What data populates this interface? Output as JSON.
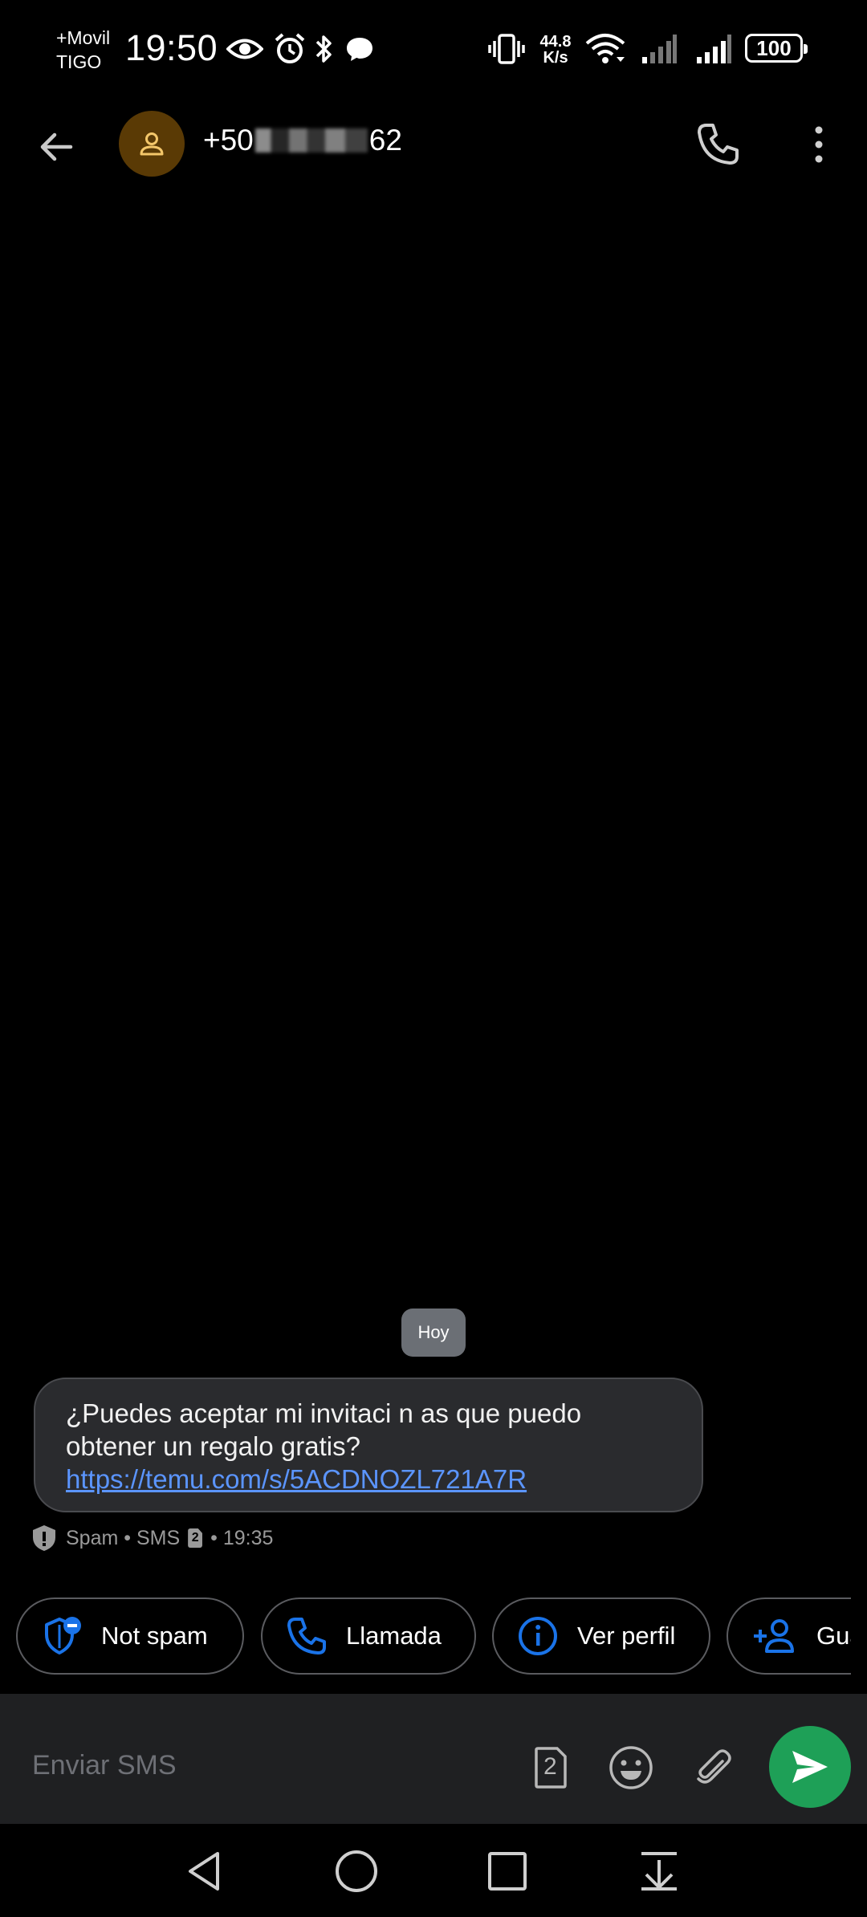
{
  "status_bar": {
    "carrier_line1": "+Movil",
    "carrier_line2": "TIGO",
    "time": "19:50",
    "net_speed_value": "44.8",
    "net_speed_unit": "K/s",
    "battery": "100"
  },
  "app_bar": {
    "contact_prefix": "+50",
    "contact_suffix": "62"
  },
  "conversation": {
    "date_label": "Hoy",
    "message": {
      "text": "¿Puedes aceptar mi invitaci n as  que puedo obtener un regalo gratis?",
      "link": "https://temu.com/s/5ACDNOZL721A7R",
      "meta_prefix": "Spam • SMS",
      "sim_number": "2",
      "meta_time": "• 19:35"
    }
  },
  "suggestions": [
    {
      "label": "Not spam",
      "icon": "shield-minus-icon"
    },
    {
      "label": "Llamada",
      "icon": "phone-icon"
    },
    {
      "label": "Ver perfil",
      "icon": "info-icon"
    },
    {
      "label": "Gua",
      "icon": "add-person-icon"
    }
  ],
  "composer": {
    "placeholder": "Enviar SMS",
    "sim_number": "2"
  },
  "colors": {
    "accent_blue": "#1a73e8",
    "link_blue": "#5b95ff",
    "send_green": "#1ea057",
    "avatar_bg": "#5a3a05",
    "avatar_icon": "#f4c76a"
  }
}
